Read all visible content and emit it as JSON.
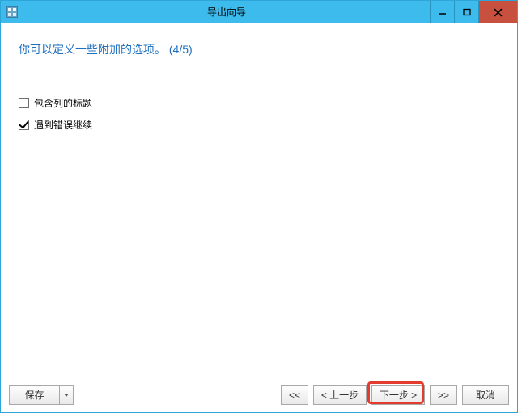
{
  "titlebar": {
    "title": "导出向导"
  },
  "content": {
    "heading": "你可以定义一些附加的选项。 (4/5)",
    "options": {
      "include_titles": {
        "label": "包含列的标题",
        "checked": false
      },
      "continue_on_error": {
        "label": "遇到错误继续",
        "checked": true
      }
    }
  },
  "footer": {
    "save": "保存",
    "first": "<<",
    "prev": "< 上一步",
    "next": "下一步 >",
    "last": ">>",
    "cancel": "取消"
  }
}
